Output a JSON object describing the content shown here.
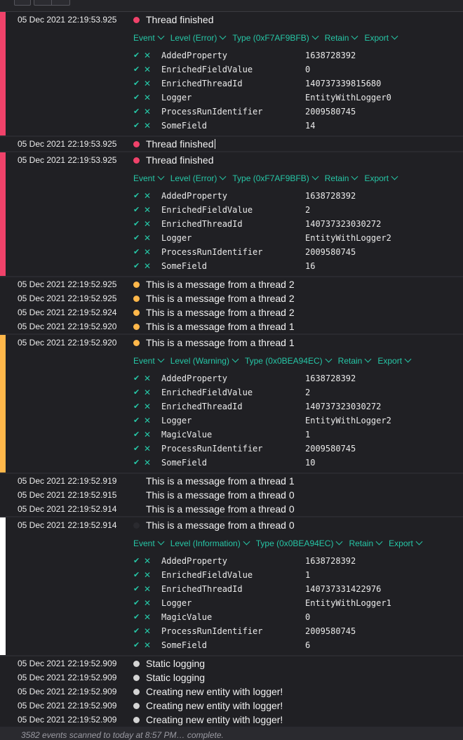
{
  "colors": {
    "error": "#f0426a",
    "warning": "#ffb74a",
    "information": "#ffffff",
    "debug": "#d4d4d4",
    "accent": "#26c6a6"
  },
  "icons": {
    "included": "check-icon",
    "excluded": "x-icon",
    "dropdown": "chevron-down-icon"
  },
  "events": [
    {
      "ts": "05 Dec 2021  22:19:53.925",
      "level": "error",
      "msg": "Thread finished",
      "expanded": true,
      "actions": [
        "Event",
        "Level (Error)",
        "Type (0xF7AF9BFB)",
        "Retain",
        "Export"
      ],
      "props": [
        {
          "name": "AddedProperty",
          "value": "1638728392"
        },
        {
          "name": "EnrichedFieldValue",
          "value": "0"
        },
        {
          "name": "EnrichedThreadId",
          "value": "140737339815680"
        },
        {
          "name": "Logger",
          "value": "EntityWithLogger0"
        },
        {
          "name": "ProcessRunIdentifier",
          "value": "2009580745"
        },
        {
          "name": "SomeField",
          "value": "14"
        }
      ]
    },
    {
      "ts": "05 Dec 2021  22:19:53.925",
      "level": "error",
      "msg": "Thread finished",
      "cursor": true
    },
    {
      "ts": "05 Dec 2021  22:19:53.925",
      "level": "error",
      "msg": "Thread finished",
      "expanded": true,
      "actions": [
        "Event",
        "Level (Error)",
        "Type (0xF7AF9BFB)",
        "Retain",
        "Export"
      ],
      "props": [
        {
          "name": "AddedProperty",
          "value": "1638728392"
        },
        {
          "name": "EnrichedFieldValue",
          "value": "2"
        },
        {
          "name": "EnrichedThreadId",
          "value": "140737323030272"
        },
        {
          "name": "Logger",
          "value": "EntityWithLogger2"
        },
        {
          "name": "ProcessRunIdentifier",
          "value": "2009580745"
        },
        {
          "name": "SomeField",
          "value": "16"
        }
      ]
    },
    {
      "ts": "05 Dec 2021  22:19:52.925",
      "level": "warning",
      "msg": "This is a message from a thread 2"
    },
    {
      "ts": "05 Dec 2021  22:19:52.925",
      "level": "warning",
      "msg": "This is a message from a thread 2"
    },
    {
      "ts": "05 Dec 2021  22:19:52.924",
      "level": "warning",
      "msg": "This is a message from a thread 2"
    },
    {
      "ts": "05 Dec 2021  22:19:52.920",
      "level": "warning",
      "msg": "This is a message from a thread 1"
    },
    {
      "ts": "05 Dec 2021  22:19:52.920",
      "level": "warning",
      "msg": "This is a message from a thread 1",
      "expanded": true,
      "actions": [
        "Event",
        "Level (Warning)",
        "Type (0x0BEA94EC)",
        "Retain",
        "Export"
      ],
      "props": [
        {
          "name": "AddedProperty",
          "value": "1638728392"
        },
        {
          "name": "EnrichedFieldValue",
          "value": "2"
        },
        {
          "name": "EnrichedThreadId",
          "value": "140737323030272"
        },
        {
          "name": "Logger",
          "value": "EntityWithLogger2"
        },
        {
          "name": "MagicValue",
          "value": "1"
        },
        {
          "name": "ProcessRunIdentifier",
          "value": "2009580745"
        },
        {
          "name": "SomeField",
          "value": "10"
        }
      ]
    },
    {
      "ts": "05 Dec 2021  22:19:52.919",
      "level": "information",
      "msg": "This is a message from a thread 1"
    },
    {
      "ts": "05 Dec 2021  22:19:52.915",
      "level": "information",
      "msg": "This is a message from a thread 0"
    },
    {
      "ts": "05 Dec 2021  22:19:52.914",
      "level": "information",
      "msg": "This is a message from a thread 0"
    },
    {
      "ts": "05 Dec 2021  22:19:52.914",
      "level": "information",
      "msg": "This is a message from a thread 0",
      "expanded": true,
      "actions": [
        "Event",
        "Level (Information)",
        "Type (0x0BEA94EC)",
        "Retain",
        "Export"
      ],
      "props": [
        {
          "name": "AddedProperty",
          "value": "1638728392"
        },
        {
          "name": "EnrichedFieldValue",
          "value": "1"
        },
        {
          "name": "EnrichedThreadId",
          "value": "140737331422976"
        },
        {
          "name": "Logger",
          "value": "EntityWithLogger1"
        },
        {
          "name": "MagicValue",
          "value": "0"
        },
        {
          "name": "ProcessRunIdentifier",
          "value": "2009580745"
        },
        {
          "name": "SomeField",
          "value": "6"
        }
      ]
    },
    {
      "ts": "05 Dec 2021  22:19:52.909",
      "level": "debug",
      "msg": "Static logging"
    },
    {
      "ts": "05 Dec 2021  22:19:52.909",
      "level": "debug",
      "msg": "Static logging"
    },
    {
      "ts": "05 Dec 2021  22:19:52.909",
      "level": "debug",
      "msg": "Creating new entity with logger!"
    },
    {
      "ts": "05 Dec 2021  22:19:52.909",
      "level": "debug",
      "msg": "Creating new entity with logger!"
    },
    {
      "ts": "05 Dec 2021  22:19:52.909",
      "level": "debug",
      "msg": "Creating new entity with logger!"
    }
  ],
  "footer": "3582 events scanned to today at 8:57 PM… complete."
}
